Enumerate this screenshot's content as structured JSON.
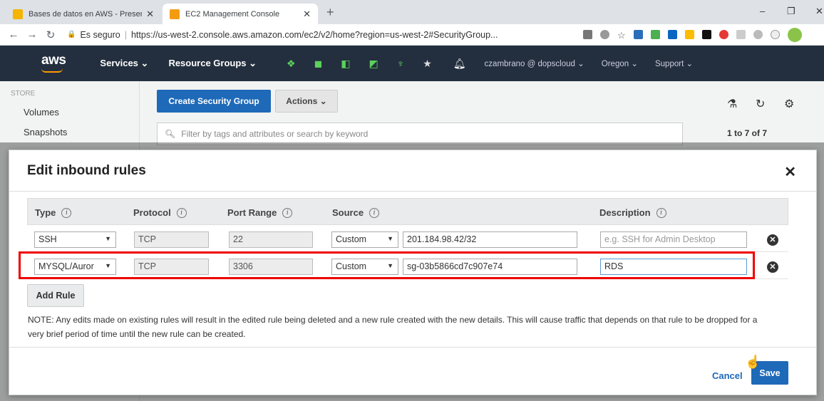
{
  "browser": {
    "tabs": [
      {
        "label": "Bases de datos en AWS - Presen",
        "favicon_color": "#f4b400"
      },
      {
        "label": "EC2 Management Console",
        "favicon_color": "#f39c12"
      }
    ],
    "new_tab": "+",
    "window_controls": [
      "–",
      "❐",
      "✕"
    ],
    "secure_label": "Es seguro",
    "url": "https://us-west-2.console.aws.amazon.com/ec2/v2/home?region=us-west-2#SecurityGroup..."
  },
  "aws_nav": {
    "logo": "aws",
    "services": "Services",
    "resource_groups": "Resource Groups",
    "user": "czambrano @ dopscloud",
    "region": "Oregon",
    "support": "Support"
  },
  "left_nav": {
    "section": "STORE",
    "items": [
      "Volumes",
      "Snapshots"
    ]
  },
  "toolbar": {
    "create_button": "Create Security Group",
    "actions_button": "Actions",
    "filter_placeholder": "Filter by tags and attributes or search by keyword",
    "pager": "1 to 7 of 7"
  },
  "modal": {
    "title": "Edit inbound rules",
    "columns": [
      "Type",
      "Protocol",
      "Port Range",
      "Source",
      "Description"
    ],
    "rows": [
      {
        "type": "SSH",
        "protocol": "TCP",
        "port": "22",
        "source_type": "Custom",
        "source": "201.184.98.42/32",
        "description_placeholder": "e.g. SSH for Admin Desktop",
        "description": ""
      },
      {
        "type": "MYSQL/Auror",
        "protocol": "TCP",
        "port": "3306",
        "source_type": "Custom",
        "source": "sg-03b5866cd7c907e74",
        "description_placeholder": "",
        "description": "RDS"
      }
    ],
    "add_rule": "Add Rule",
    "note": "NOTE: Any edits made on existing rules will result in the edited rule being deleted and a new rule created with the new details. This will cause traffic that depends on that rule to be dropped for a very brief period of time until the new rule can be created.",
    "cancel": "Cancel",
    "save": "Save"
  },
  "colors": {
    "accent": "#1e69b8",
    "nav_bg": "#232f3e",
    "highlight": "#ee0000"
  }
}
